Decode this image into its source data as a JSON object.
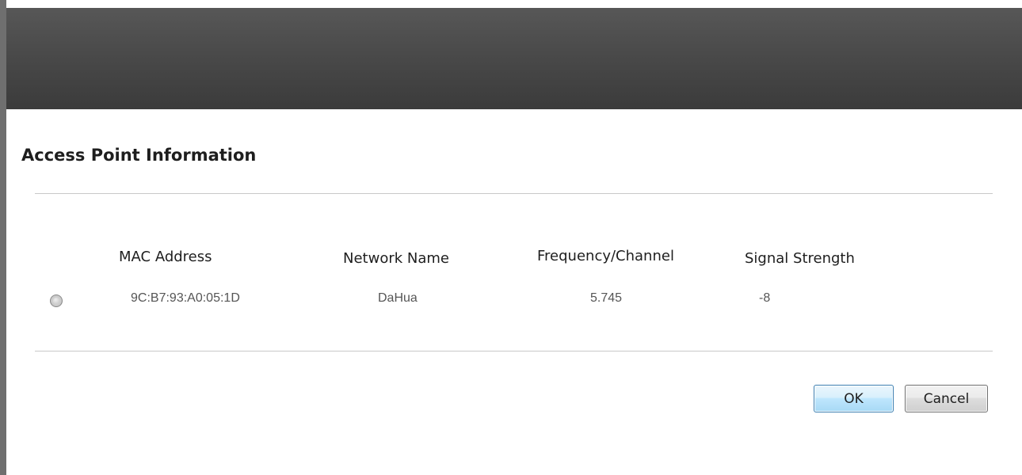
{
  "dialog": {
    "title": "Access Point Information"
  },
  "table": {
    "columns": [
      "MAC Address",
      "Network Name",
      "Frequency/Channel",
      "Signal Strength"
    ],
    "rows": [
      {
        "selected": false,
        "mac": "9C:B7:93:A0:05:1D",
        "network": "DaHua",
        "frequency": "5.745",
        "signal": "-8"
      }
    ]
  },
  "buttons": {
    "ok_label": "OK",
    "cancel_label": "Cancel"
  },
  "colors": {
    "header_bar": "#474747",
    "ok_accent": "#3c7fb1"
  },
  "icons": {
    "row_selector": "radio-button-icon"
  }
}
